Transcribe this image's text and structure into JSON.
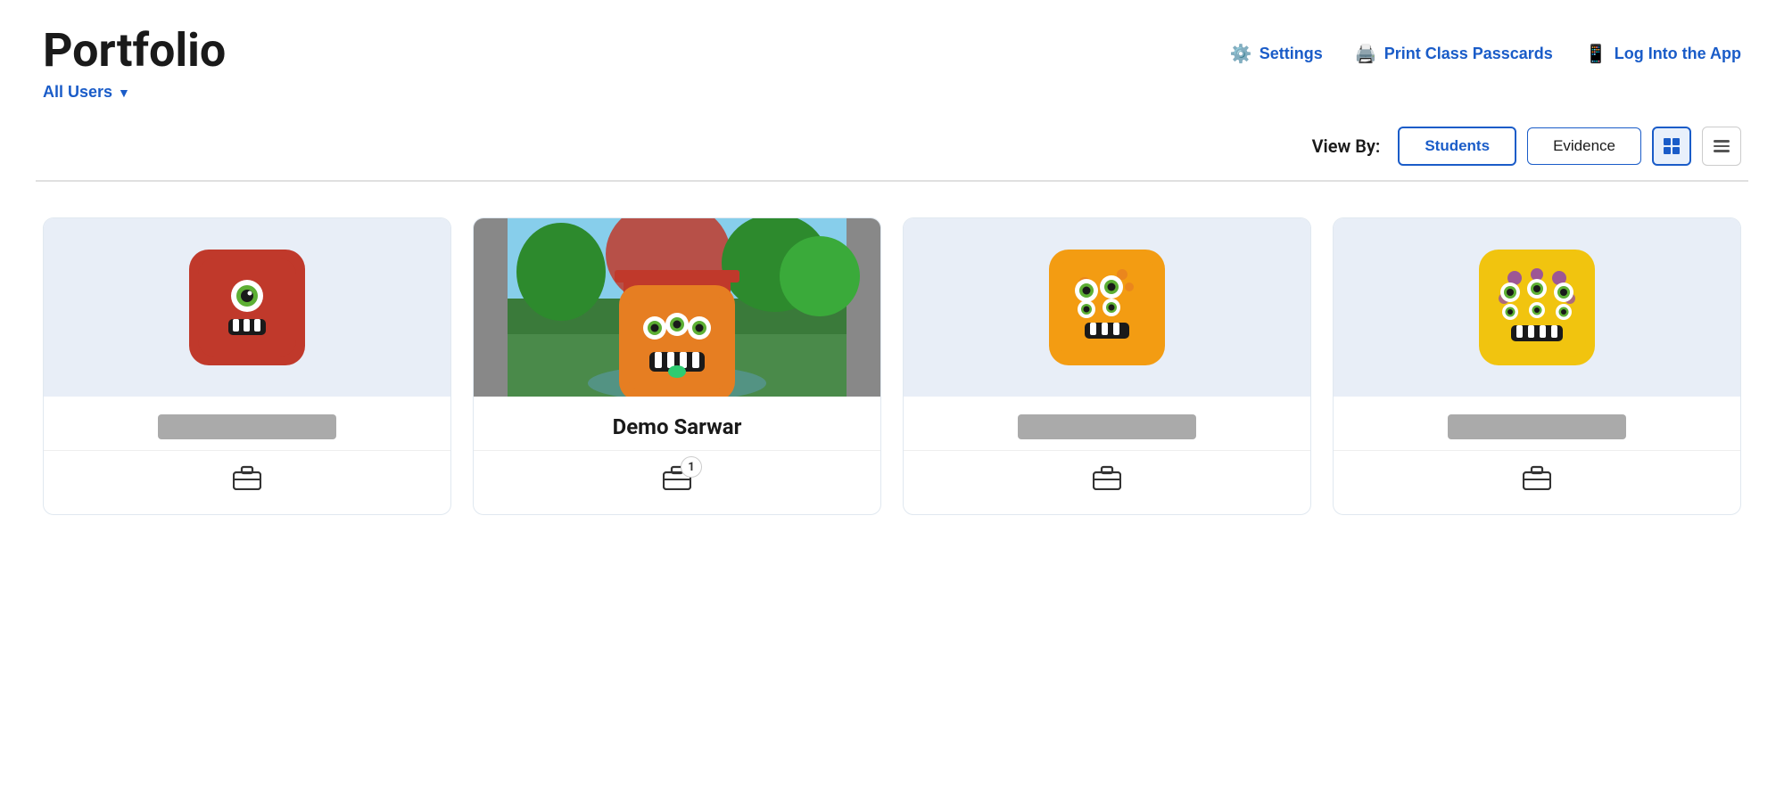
{
  "page": {
    "title": "Portfolio"
  },
  "header": {
    "all_users_label": "All Users",
    "settings_label": "Settings",
    "print_label": "Print Class Passcards",
    "login_label": "Log Into the App"
  },
  "toolbar": {
    "view_by_label": "View By:",
    "students_label": "Students",
    "evidence_label": "Evidence"
  },
  "students": [
    {
      "id": 1,
      "name": "",
      "has_photo": false,
      "monster": "1",
      "badge_count": null
    },
    {
      "id": 2,
      "name": "Demo Sarwar",
      "has_photo": true,
      "monster": "2",
      "badge_count": 1
    },
    {
      "id": 3,
      "name": "",
      "has_photo": false,
      "monster": "3",
      "badge_count": null
    },
    {
      "id": 4,
      "name": "",
      "has_photo": false,
      "monster": "4",
      "badge_count": null
    }
  ]
}
